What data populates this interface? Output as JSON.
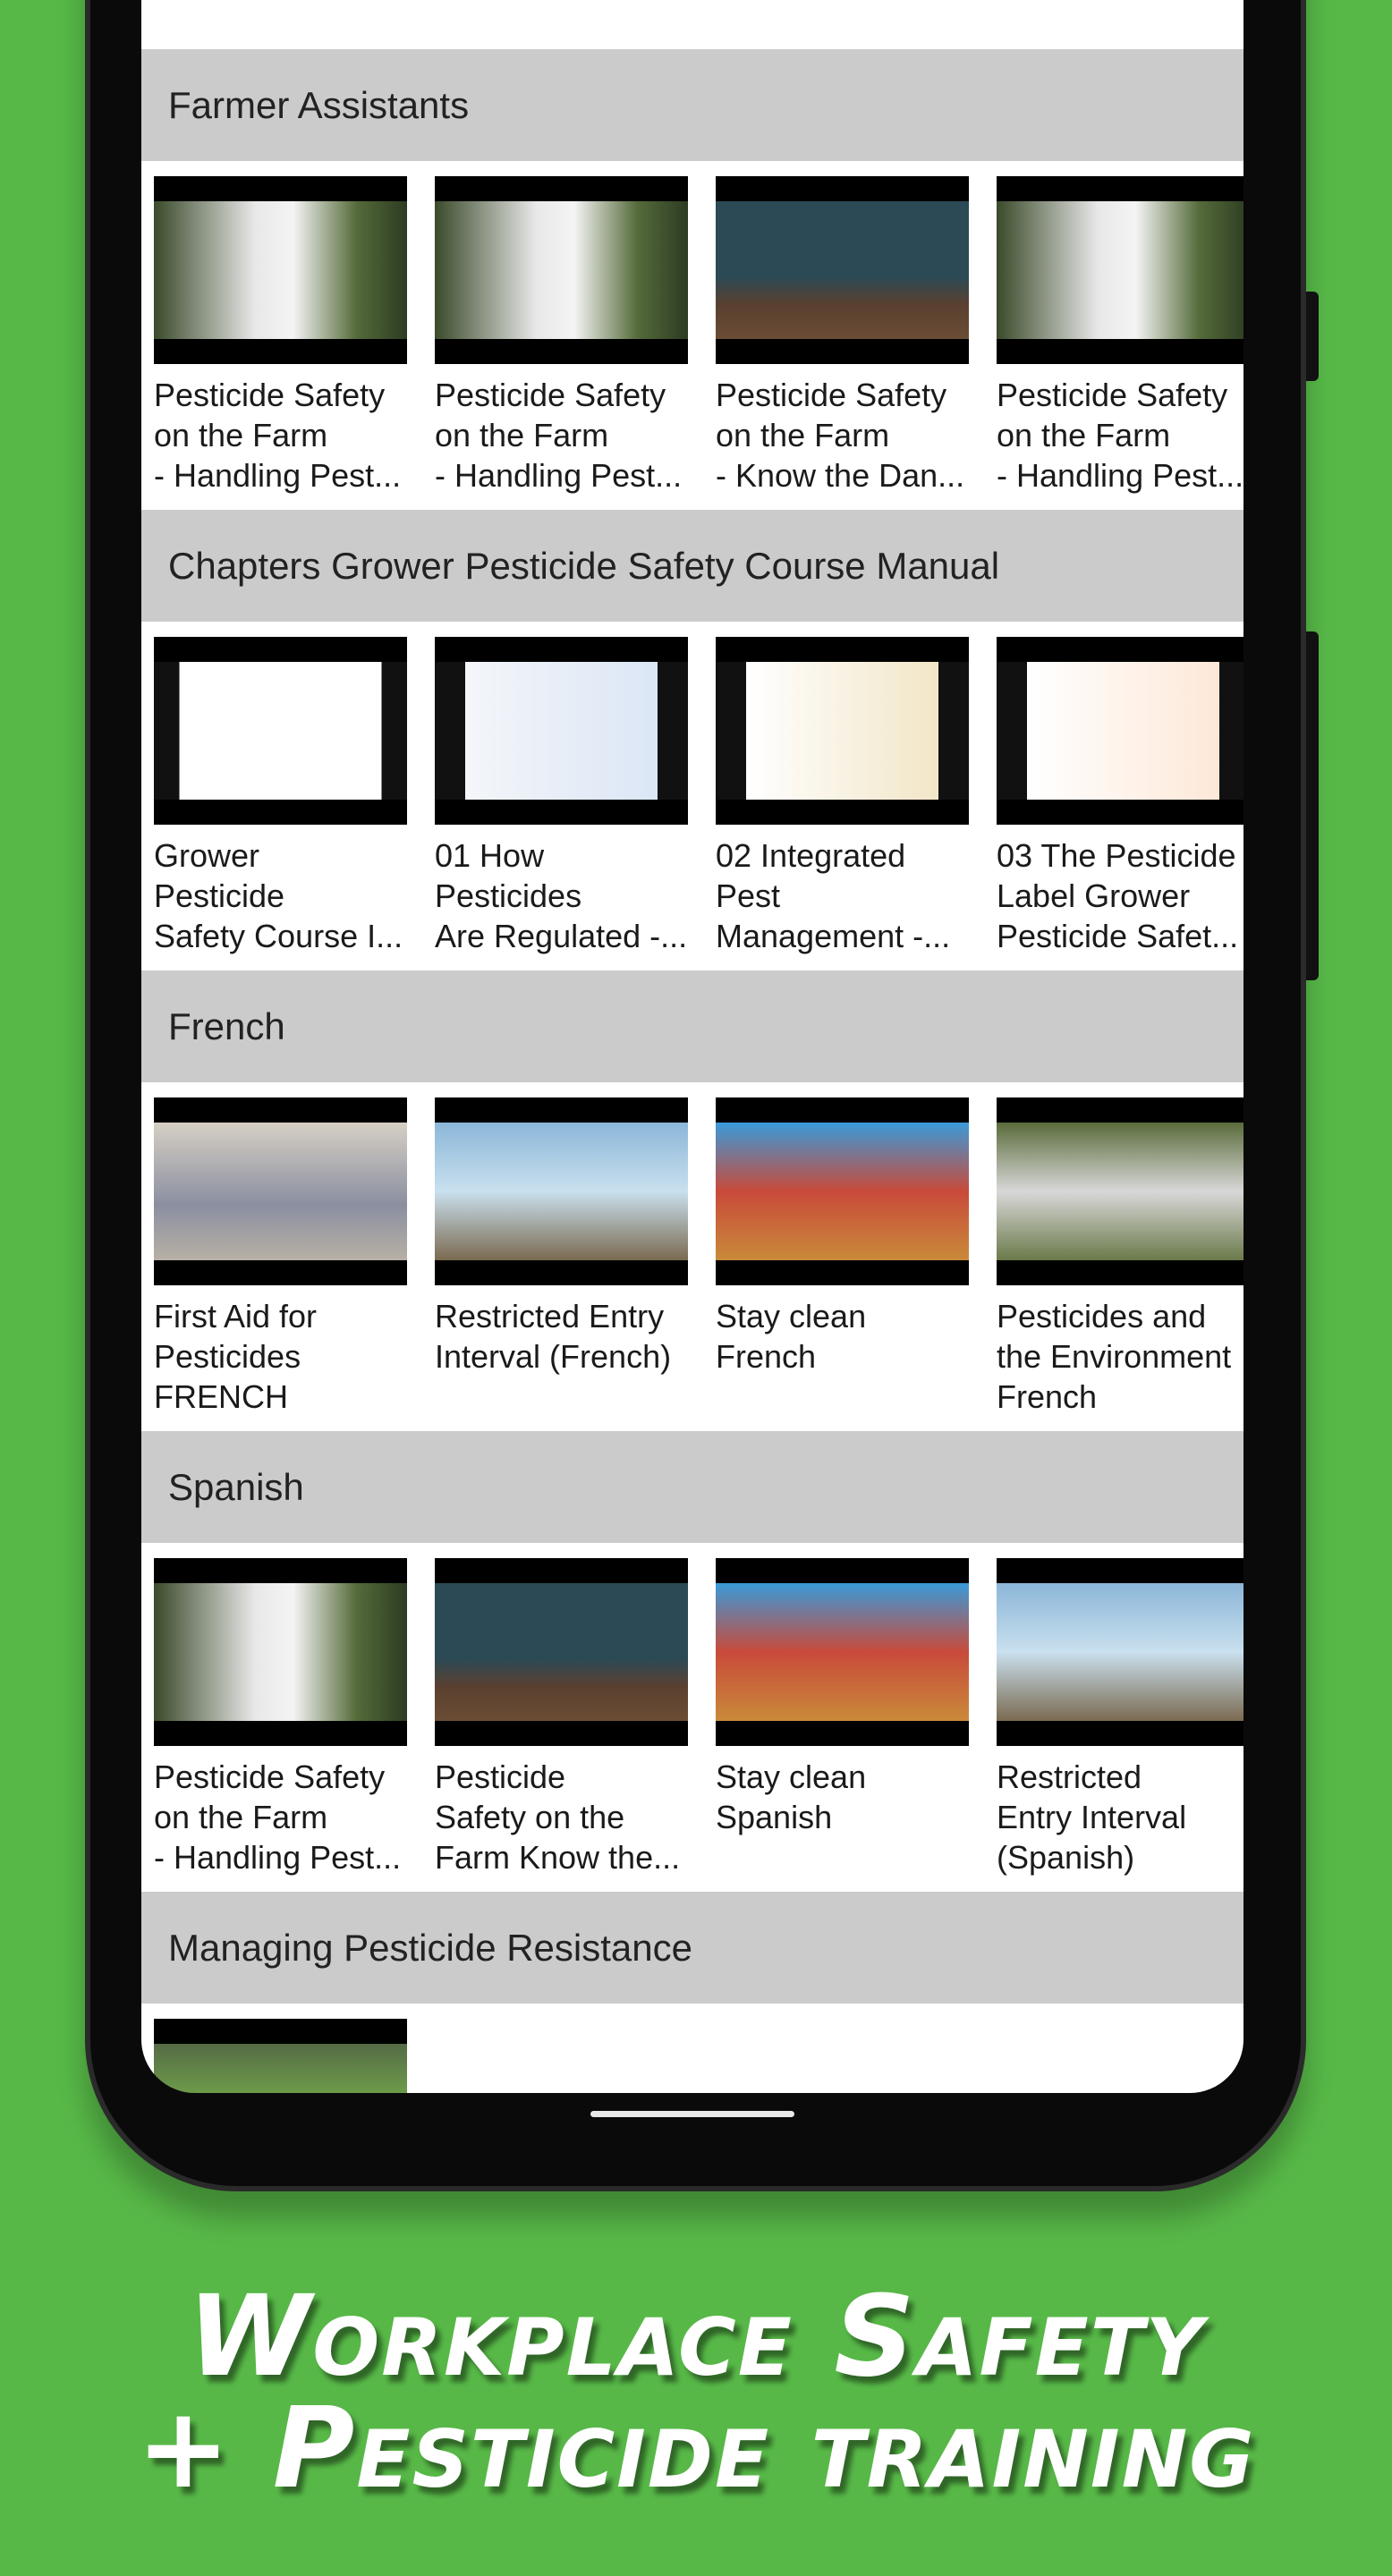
{
  "sections": [
    {
      "title": "Farmer Assistants",
      "items": [
        {
          "lines": [
            "Pesticide Safety",
            "on the Farm",
            "- Handling Pest..."
          ]
        },
        {
          "lines": [
            "Pesticide Safety",
            "on the Farm",
            "- Handling Pest..."
          ]
        },
        {
          "lines": [
            "Pesticide Safety",
            "on the Farm",
            "- Know the Dan..."
          ]
        },
        {
          "lines": [
            "Pesticide Safety",
            "on the Farm",
            "- Handling Pest..."
          ]
        }
      ]
    },
    {
      "title": "Chapters Grower Pesticide Safety Course Manual",
      "items": [
        {
          "lines": [
            "Grower",
            "Pesticide",
            "Safety Course I..."
          ]
        },
        {
          "lines": [
            "01 How",
            "Pesticides",
            "Are Regulated -..."
          ]
        },
        {
          "lines": [
            "02  Integrated",
            "Pest",
            "Management  -..."
          ]
        },
        {
          "lines": [
            "03 The Pesticide",
            "Label  Grower",
            "Pesticide Safet..."
          ]
        }
      ]
    },
    {
      "title": "French",
      "items": [
        {
          "lines": [
            "First Aid for",
            "Pesticides",
            "FRENCH"
          ]
        },
        {
          "lines": [
            "Restricted Entry",
            "Interval (French)",
            ""
          ]
        },
        {
          "lines": [
            "Stay clean",
            "French",
            ""
          ]
        },
        {
          "lines": [
            "Pesticides and",
            "the Environment",
            "French"
          ]
        }
      ]
    },
    {
      "title": "Spanish",
      "items": [
        {
          "lines": [
            "Pesticide Safety",
            "on the Farm",
            "- Handling Pest..."
          ]
        },
        {
          "lines": [
            "Pesticide",
            "Safety on the",
            "Farm Know the..."
          ]
        },
        {
          "lines": [
            "Stay clean",
            "Spanish",
            ""
          ]
        },
        {
          "lines": [
            "Restricted",
            "Entry Interval",
            "(Spanish)"
          ]
        }
      ]
    },
    {
      "title": "Managing Pesticide Resistance",
      "items": [
        {
          "lines": [
            "",
            "",
            ""
          ]
        }
      ]
    }
  ],
  "promo": {
    "line1": "Workplace Safety",
    "line2": "+ Pesticide training"
  },
  "colors": {
    "background": "#57b847",
    "section_header": "#cbcbcb"
  }
}
